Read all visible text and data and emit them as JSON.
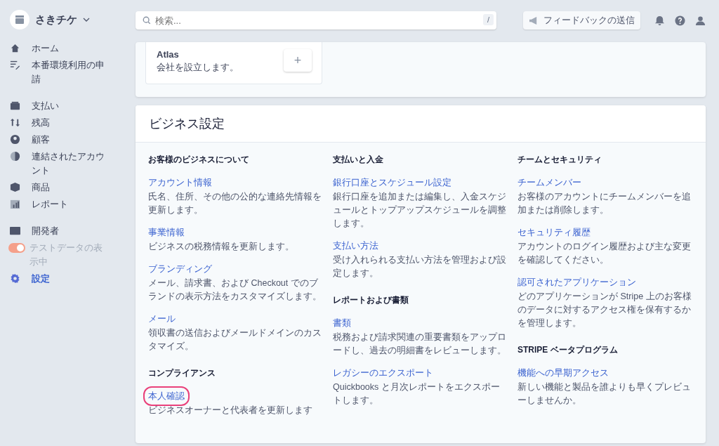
{
  "account": {
    "name": "さきチケ"
  },
  "sidebar": {
    "groups": [
      {
        "items": [
          {
            "kind": "link",
            "label": "ホーム",
            "selected": false
          },
          {
            "kind": "link",
            "label": "本番環境利用の申請",
            "selected": false
          }
        ]
      },
      {
        "items": [
          {
            "kind": "link",
            "label": "支払い",
            "selected": false
          },
          {
            "kind": "link",
            "label": "残高",
            "selected": false
          },
          {
            "kind": "link",
            "label": "顧客",
            "selected": false
          },
          {
            "kind": "link",
            "label": "連結されたアカウント",
            "selected": false
          },
          {
            "kind": "link",
            "label": "商品",
            "selected": false
          },
          {
            "kind": "link",
            "label": "レポート",
            "selected": false
          }
        ]
      },
      {
        "items": [
          {
            "kind": "link",
            "label": "開発者",
            "selected": false
          },
          {
            "kind": "toggle",
            "label": "テストデータの表示中",
            "on": true
          },
          {
            "kind": "link",
            "label": "設定",
            "selected": true
          }
        ]
      }
    ]
  },
  "search": {
    "placeholder": "検索...",
    "shortcut": "/"
  },
  "feedback_button": "フィードバックの送信",
  "app_card": {
    "title": "Atlas",
    "description": "会社を設立します。",
    "add_button": "+"
  },
  "settings": {
    "title": "ビジネス設定",
    "columns": [
      {
        "sections": [
          {
            "heading": "お客様のビジネスについて",
            "links": [
              {
                "title": "アカウント情報",
                "description": "氏名、住所、その他の公的な連絡先情報を更新します。",
                "highlighted": false
              },
              {
                "title": "事業情報",
                "description": "ビジネスの税務情報を更新します。",
                "highlighted": false
              },
              {
                "title": "ブランディング",
                "description": "メール、請求書、および Checkout でのブランドの表示方法をカスタマイズします。",
                "highlighted": false
              },
              {
                "title": "メール",
                "description": "領収書の送信およびメールドメインのカスタマイズ。",
                "highlighted": false
              }
            ]
          },
          {
            "heading": "コンプライアンス",
            "links": [
              {
                "title": "本人確認",
                "description": "ビジネスオーナーと代表者を更新します",
                "highlighted": true
              }
            ]
          }
        ]
      },
      {
        "sections": [
          {
            "heading": "支払いと入金",
            "links": [
              {
                "title": "銀行口座とスケジュール設定",
                "description": "銀行口座を追加または編集し、入金スケジュールとトップアップスケジュールを調整します。",
                "highlighted": false
              },
              {
                "title": "支払い方法",
                "description": "受け入れられる支払い方法を管理および設定します。",
                "highlighted": false
              }
            ]
          },
          {
            "heading": "レポートおよび書類",
            "links": [
              {
                "title": "書類",
                "description": "税務および請求関連の重要書類をアップロードし、過去の明細書をレビューします。",
                "highlighted": false
              },
              {
                "title": "レガシーのエクスポート",
                "description": "Quickbooks と月次レポートをエクスポートします。",
                "highlighted": false
              }
            ]
          }
        ]
      },
      {
        "sections": [
          {
            "heading": "チームとセキュリティ",
            "links": [
              {
                "title": "チームメンバー",
                "description": "お客様のアカウントにチームメンバーを追加または削除します。",
                "highlighted": false
              },
              {
                "title": "セキュリティ履歴",
                "description": "アカウントのログイン履歴および主な変更を確認してください。",
                "highlighted": false
              },
              {
                "title": "認可されたアプリケーション",
                "description": "どのアプリケーションが Stripe 上のお客様のデータに対するアクセス権を保有するかを管理します。",
                "highlighted": false
              }
            ]
          },
          {
            "heading": "STRIPE ベータプログラム",
            "links": [
              {
                "title": "機能への早期アクセス",
                "description": "新しい機能と製品を誰よりも早くプレビューしませんか。",
                "highlighted": false
              }
            ]
          }
        ]
      }
    ]
  }
}
